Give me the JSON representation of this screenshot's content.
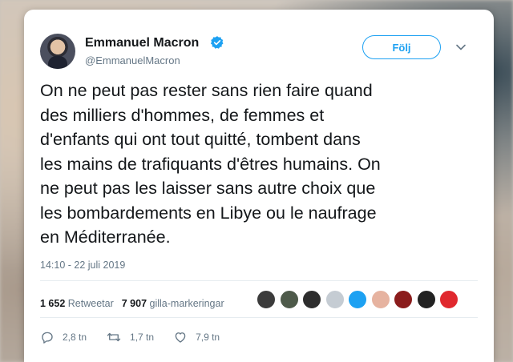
{
  "author": {
    "name": "Emmanuel Macron",
    "handle": "@EmmanuelMacron"
  },
  "follow_button": {
    "label": "Följ"
  },
  "tweet": {
    "lines": [
      "On ne peut pas rester sans rien faire quand",
      "des milliers d'hommes, de femmes et",
      "d'enfants qui ont tout quitté, tombent dans",
      "les mains de trafiquants d'êtres humains. On",
      "ne peut pas les laisser sans autre choix que",
      "les bombardements en Libye ou le naufrage",
      "en Méditerranée."
    ],
    "timestamp": "14:10 - 22 juli 2019"
  },
  "stats": {
    "retweets_count": "1 652",
    "retweets_label": "Retweetar",
    "likes_count": "7 907",
    "likes_label": "gilla-markeringar"
  },
  "likers": [
    {
      "icon": "user-avatar",
      "color": "#3b3b3b"
    },
    {
      "icon": "user-avatar",
      "color": "#4e5a4a"
    },
    {
      "icon": "user-avatar",
      "color": "#2d2d2d"
    },
    {
      "icon": "default-avatar",
      "color": "#c5ccd3"
    },
    {
      "icon": "user-avatar",
      "color": "#1da1f2"
    },
    {
      "icon": "user-avatar",
      "color": "#e6b3a0"
    },
    {
      "icon": "user-avatar",
      "color": "#8b1c1c"
    },
    {
      "icon": "user-avatar",
      "color": "#222222"
    },
    {
      "icon": "user-avatar",
      "color": "#e0282e"
    }
  ],
  "actions": {
    "replies": "2,8 tn",
    "retweets": "1,7 tn",
    "likes": "7,9 tn"
  },
  "colors": {
    "accent": "#1da1f2",
    "secondary_text": "#657786",
    "primary_text": "#14171a"
  }
}
